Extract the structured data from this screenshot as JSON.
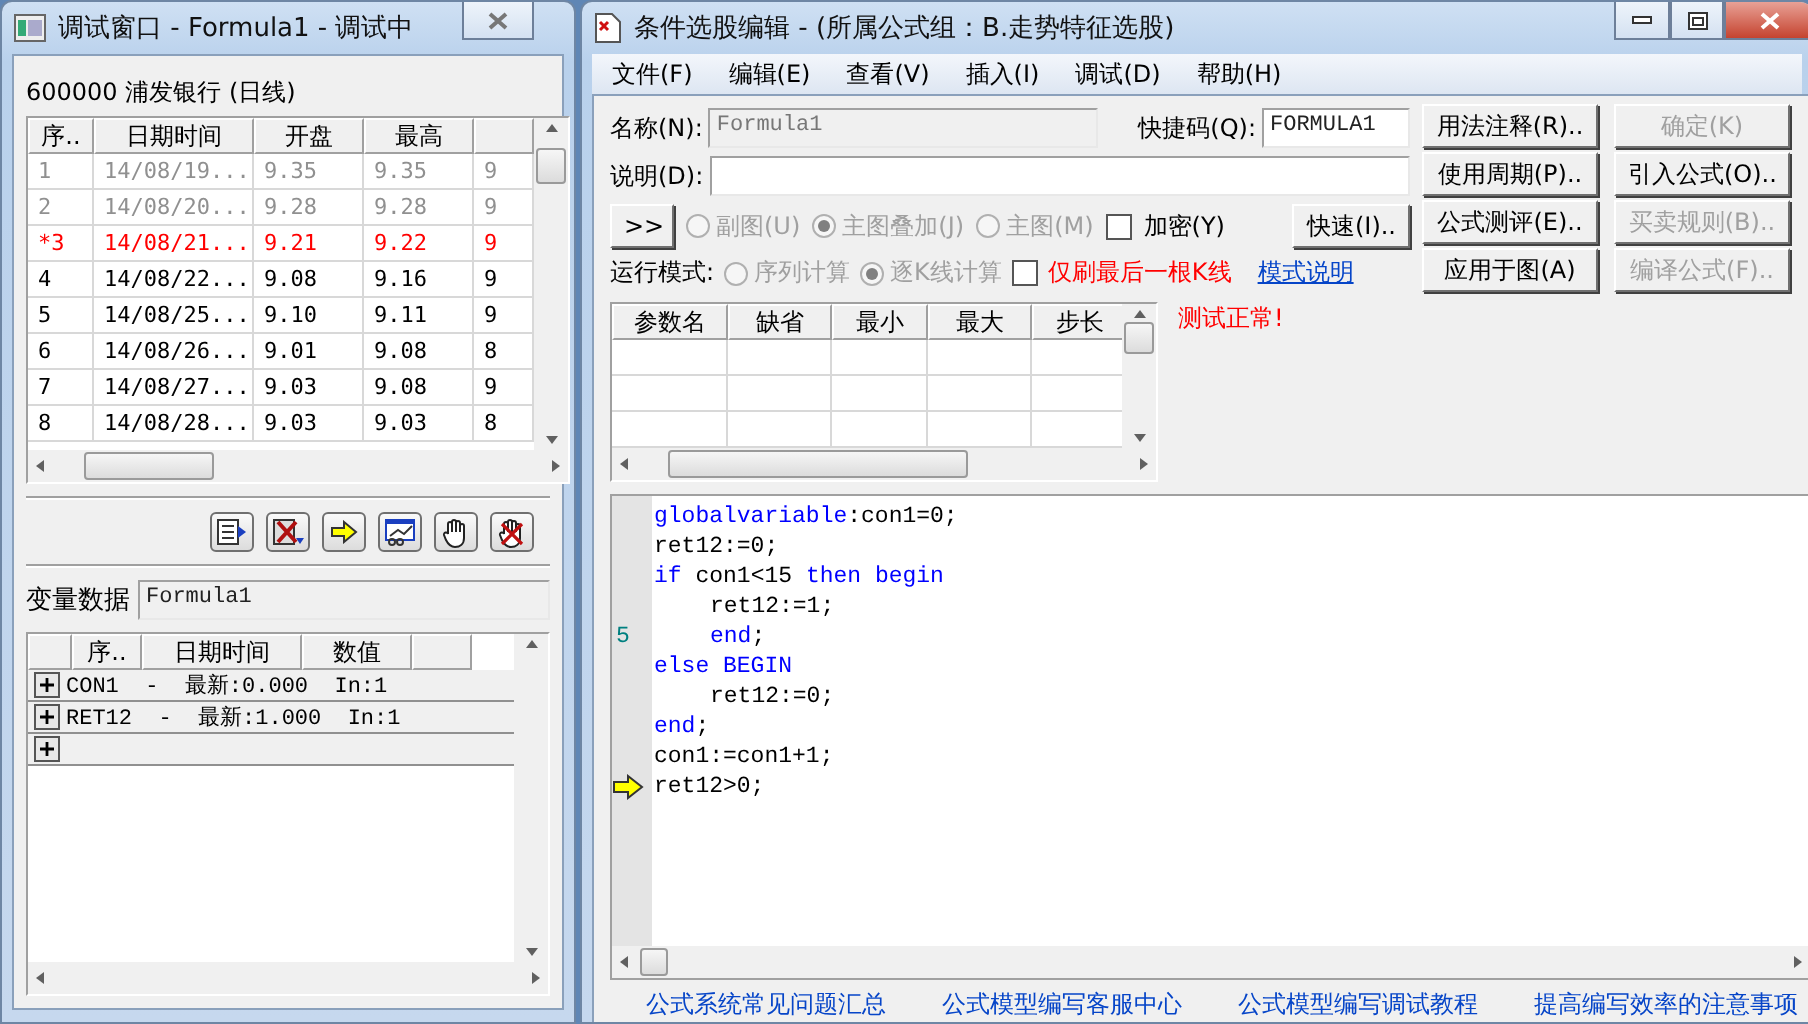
{
  "debug_window": {
    "title": "调试窗口  -  Formula1 - 调试中",
    "stock_label": "600000 浦发银行 (日线)",
    "bars_table": {
      "columns": [
        "序..",
        "日期时间",
        "开盘",
        "最高"
      ],
      "rows": [
        {
          "cells": [
            "1",
            "14/08/19...",
            "9.35",
            "9.35",
            "9"
          ],
          "kind": "past"
        },
        {
          "cells": [
            "2",
            "14/08/20...",
            "9.28",
            "9.28",
            "9"
          ],
          "kind": "past"
        },
        {
          "cells": [
            "*3",
            "14/08/21...",
            "9.21",
            "9.22",
            "9"
          ],
          "kind": "current"
        },
        {
          "cells": [
            "4",
            "14/08/22...",
            "9.08",
            "9.16",
            "9"
          ],
          "kind": "normal"
        },
        {
          "cells": [
            "5",
            "14/08/25...",
            "9.10",
            "9.11",
            "9"
          ],
          "kind": "normal"
        },
        {
          "cells": [
            "6",
            "14/08/26...",
            "9.01",
            "9.08",
            "8"
          ],
          "kind": "normal"
        },
        {
          "cells": [
            "7",
            "14/08/27...",
            "9.03",
            "9.08",
            "9"
          ],
          "kind": "normal"
        },
        {
          "cells": [
            "8",
            "14/08/28...",
            "9.03",
            "9.03",
            "8"
          ],
          "kind": "normal"
        }
      ]
    },
    "variables_label": "变量数据",
    "variables_value": "Formula1",
    "variables_table": {
      "columns": [
        "序..",
        "日期时间",
        "数值"
      ],
      "rows": [
        {
          "text": "CON1  -  最新:0.000  In:1",
          "expanded": false
        },
        {
          "text": "RET12  -  最新:1.000  In:1",
          "expanded": false
        },
        {
          "expanded": false
        }
      ]
    }
  },
  "editor_window": {
    "title": "条件选股编辑 - (所属公式组：B.走势特征选股)",
    "menu": [
      "文件(F)",
      "编辑(E)",
      "查看(V)",
      "插入(I)",
      "调试(D)",
      "帮助(H)"
    ],
    "name_label": "名称(N):",
    "name_value": "Formula1",
    "hotkey_label": "快捷码(Q):",
    "hotkey_value": "FORMULA1",
    "desc_label": "说明(D):",
    "expand_button": ">>",
    "chart_types": [
      {
        "label": "副图(U)",
        "selected": false,
        "disabled": true
      },
      {
        "label": "主图叠加(J)",
        "selected": true,
        "disabled": true
      },
      {
        "label": "主图(M)",
        "selected": false,
        "disabled": true
      }
    ],
    "encrypt": {
      "label": "加密(Y)",
      "checked": false
    },
    "fast_button": "快速(I)..",
    "run_mode_label": "运行模式:",
    "run_modes": [
      {
        "label": "序列计算",
        "selected": false,
        "disabled": true
      },
      {
        "label": "逐K线计算",
        "selected": true,
        "disabled": true
      }
    ],
    "last_bar_only": {
      "label": "仅刷最后一根K线",
      "checked": false
    },
    "mode_help_link": "模式说明",
    "params_table": {
      "columns": [
        "参数名",
        "缺省",
        "最小",
        "最大",
        "步长"
      ]
    },
    "test_status": "测试正常!",
    "buttons": [
      {
        "label": "用法注释(R)..",
        "disabled": false
      },
      {
        "label": "确定(K)",
        "disabled": true
      },
      {
        "label": "使用周期(P)..",
        "disabled": false
      },
      {
        "label": "引入公式(O)..",
        "disabled": false
      },
      {
        "label": "公式测评(E)..",
        "disabled": false
      },
      {
        "label": "买卖规则(B)..",
        "disabled": true
      },
      {
        "label": "应用于图(A)",
        "disabled": false
      },
      {
        "label": "编译公式(F)..",
        "disabled": true
      }
    ],
    "code_lines": [
      {
        "indented": false,
        "current": false,
        "segments": [
          {
            "text": "globalvariable",
            "kind": "keyword"
          },
          {
            "text": ":con1=0;",
            "kind": "plain"
          }
        ]
      },
      {
        "indented": false,
        "current": false,
        "segments": [
          {
            "text": "ret12:=0;",
            "kind": "plain"
          }
        ]
      },
      {
        "indented": false,
        "current": false,
        "segments": [
          {
            "text": "if",
            "kind": "keyword"
          },
          {
            "text": " con1<15 ",
            "kind": "plain"
          },
          {
            "text": "then begin",
            "kind": "keyword"
          }
        ]
      },
      {
        "indented": true,
        "current": false,
        "segments": [
          {
            "text": "ret12:=1;",
            "kind": "plain"
          }
        ]
      },
      {
        "indented": true,
        "current": false,
        "marker": "5",
        "segments": [
          {
            "text": "end",
            "kind": "keyword"
          },
          {
            "text": ";",
            "kind": "plain"
          }
        ]
      },
      {
        "indented": false,
        "current": false,
        "segments": [
          {
            "text": "else BEGIN",
            "kind": "keyword"
          }
        ]
      },
      {
        "indented": true,
        "current": false,
        "segments": [
          {
            "text": "ret12:=0;",
            "kind": "plain"
          }
        ]
      },
      {
        "indented": false,
        "current": false,
        "segments": [
          {
            "text": "end",
            "kind": "keyword"
          },
          {
            "text": ";",
            "kind": "plain"
          }
        ]
      },
      {
        "indented": false,
        "current": false,
        "segments": [
          {
            "text": "con1:=con1+1;",
            "kind": "plain"
          }
        ]
      },
      {
        "indented": false,
        "current": true,
        "segments": [
          {
            "text": "ret12>0;",
            "kind": "plain"
          }
        ]
      }
    ],
    "links": [
      "公式系统常见问题汇总",
      "公式模型编写客服中心",
      "公式模型编写调试教程",
      "提高编写效率的注意事项"
    ]
  }
}
